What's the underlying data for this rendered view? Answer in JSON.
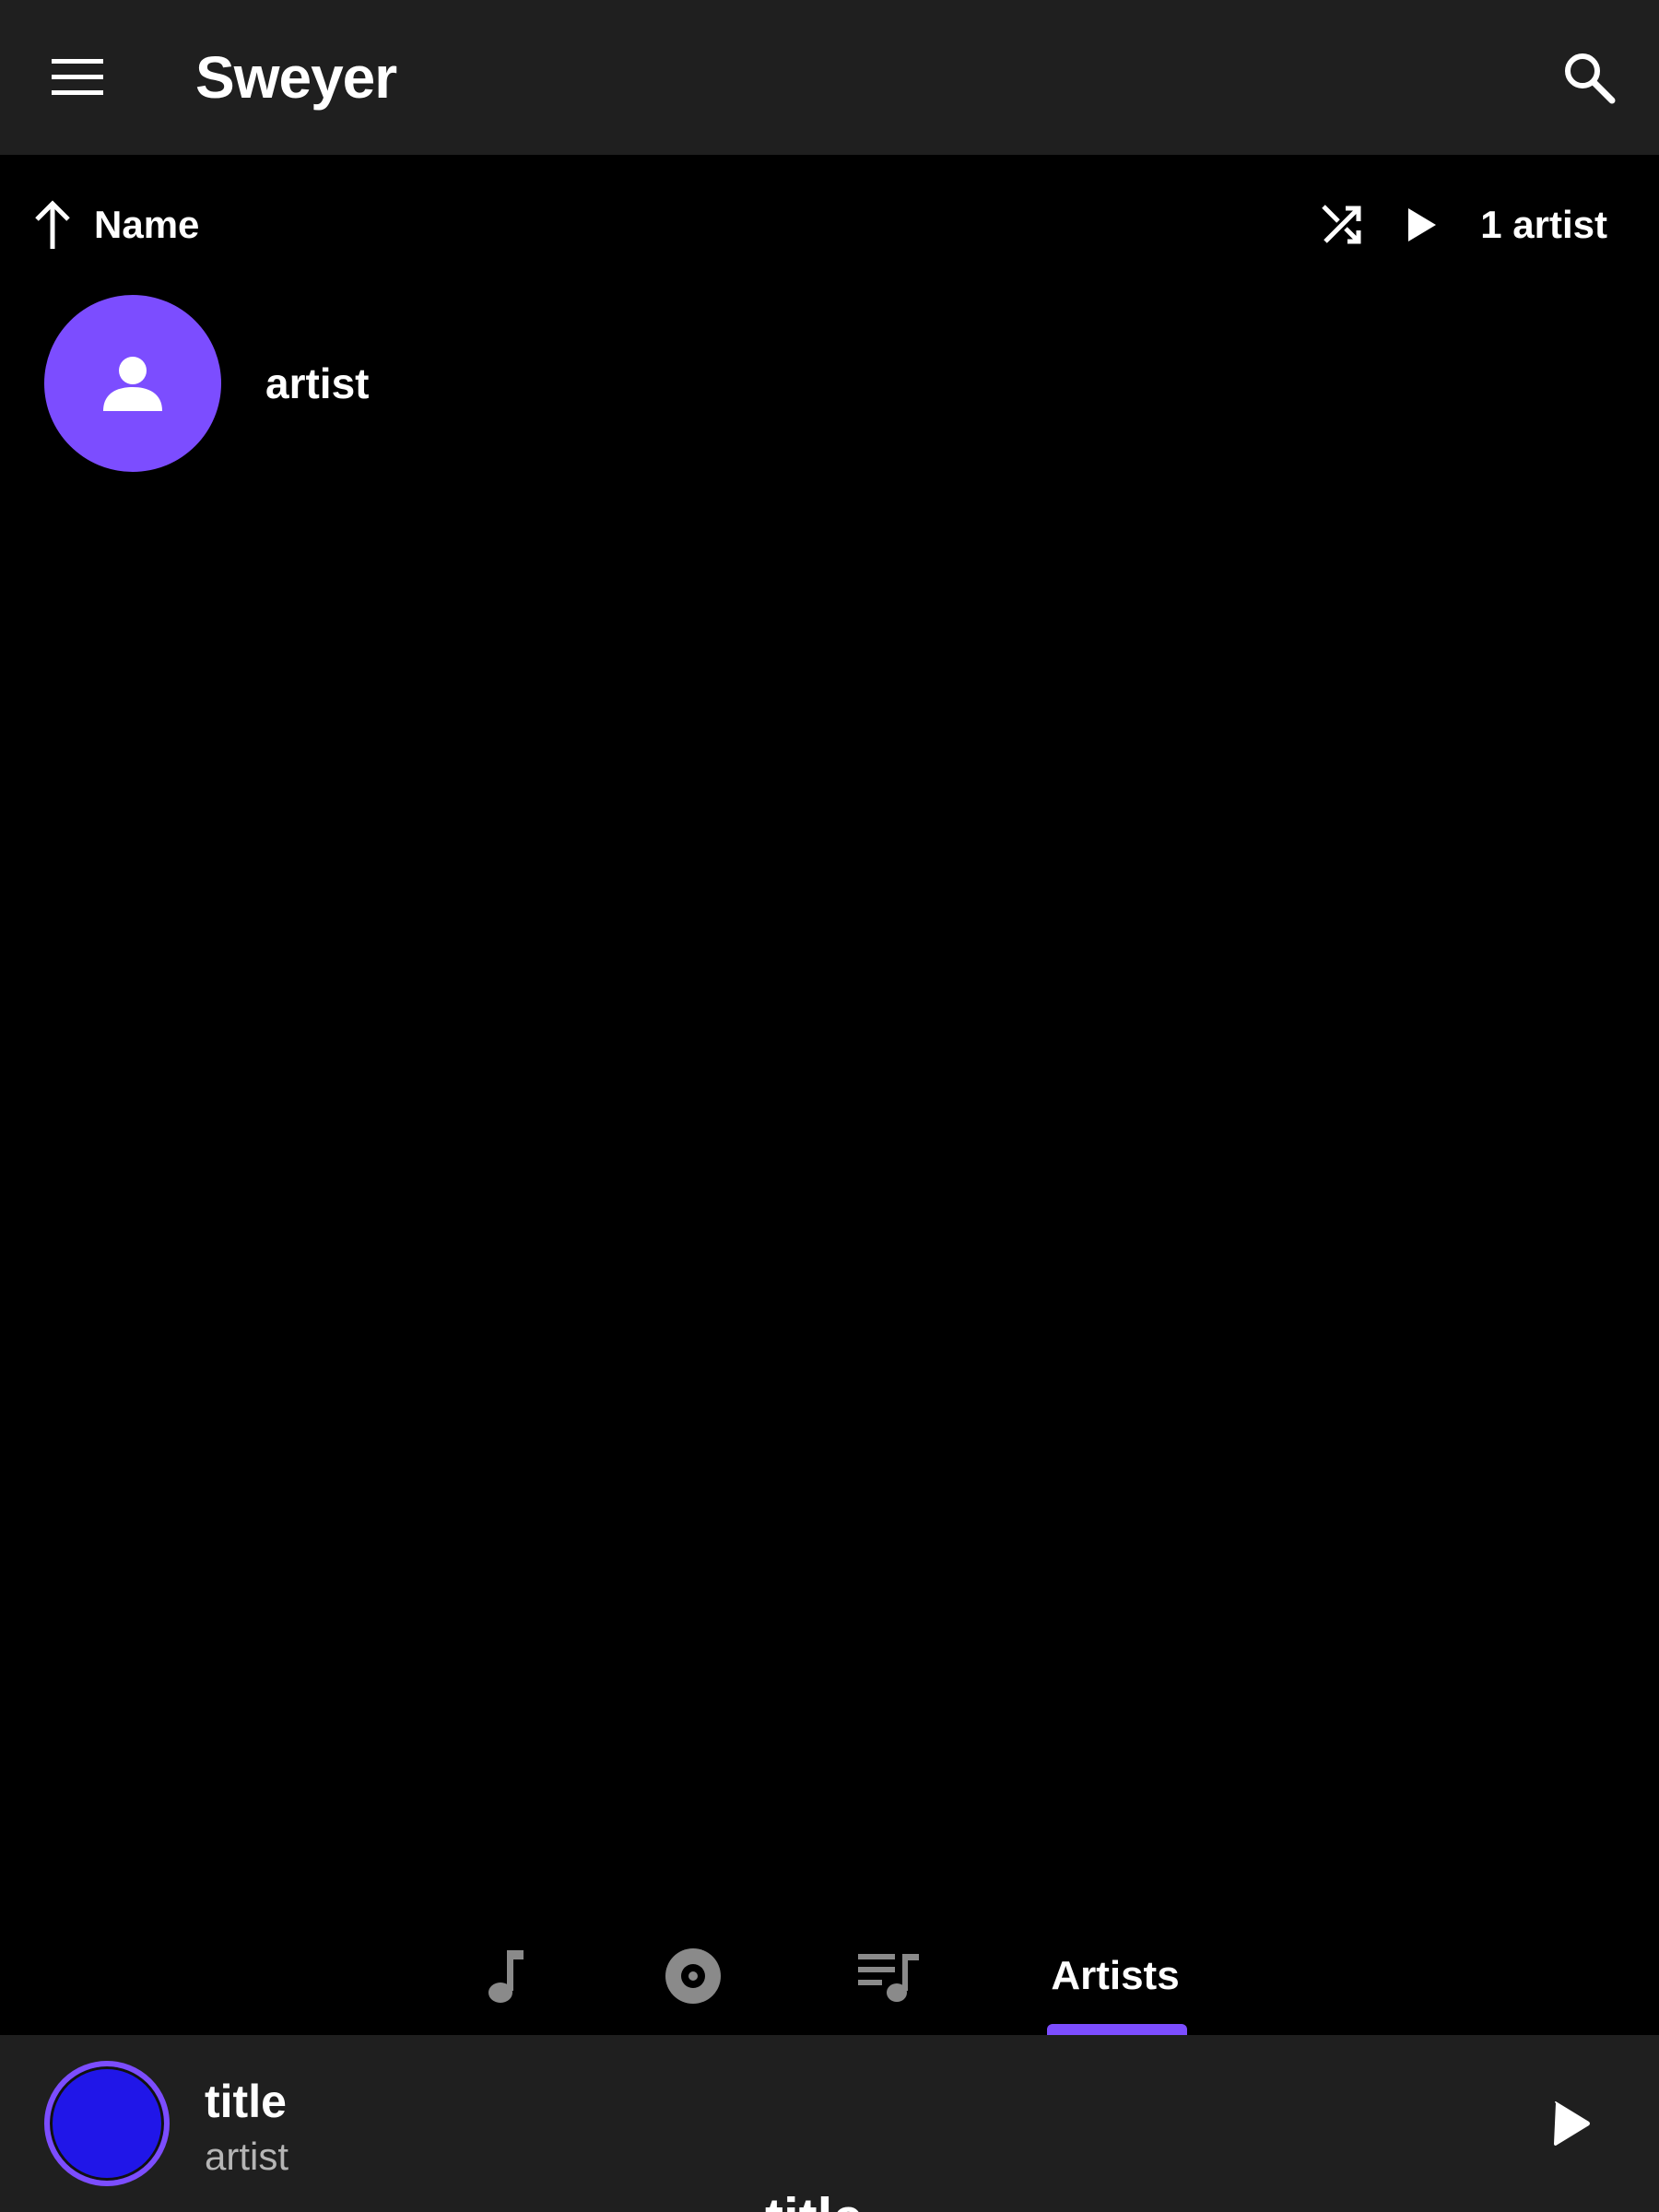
{
  "app": {
    "title": "Sweyer"
  },
  "sort": {
    "direction_icon": "arrow-up-icon",
    "label": "Name"
  },
  "actions": {
    "shuffle_icon": "shuffle-icon",
    "play_icon": "play-icon",
    "count_label": "1 artist"
  },
  "artists": [
    {
      "name": "artist",
      "icon": "person-icon"
    }
  ],
  "tabs": [
    {
      "id": "songs",
      "icon": "music-note-icon",
      "label": "",
      "active": false
    },
    {
      "id": "albums",
      "icon": "album-icon",
      "label": "",
      "active": false
    },
    {
      "id": "playlists",
      "icon": "playlist-icon",
      "label": "",
      "active": false
    },
    {
      "id": "artists",
      "icon": "",
      "label": "Artists",
      "active": true
    }
  ],
  "player": {
    "title": "title",
    "artist": "artist",
    "peek_title": "title"
  },
  "colors": {
    "accent": "#7c4dff",
    "appbar": "#1f1f1f",
    "background": "#000000",
    "cover": "#2016e8"
  }
}
